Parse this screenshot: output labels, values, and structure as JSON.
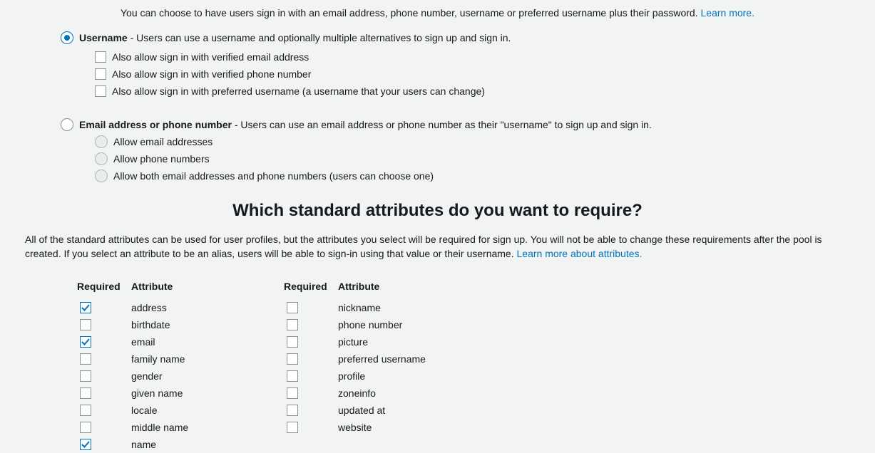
{
  "intro": {
    "text": "You can choose to have users sign in with an email address, phone number, username or preferred username plus their password. ",
    "link": "Learn more."
  },
  "signin": {
    "username": {
      "label": "Username",
      "desc": " - Users can use a username and optionally multiple alternatives to sign up and sign in.",
      "selected": true,
      "subs": [
        {
          "label": "Also allow sign in with verified email address",
          "checked": false
        },
        {
          "label": "Also allow sign in with verified phone number",
          "checked": false
        },
        {
          "label": "Also allow sign in with preferred username (a username that your users can change)",
          "checked": false
        }
      ]
    },
    "emailphone": {
      "label": "Email address or phone number",
      "desc": " - Users can use an email address or phone number as their \"username\" to sign up and sign in.",
      "selected": false,
      "subs": [
        {
          "label": "Allow email addresses"
        },
        {
          "label": "Allow phone numbers"
        },
        {
          "label": "Allow both email addresses and phone numbers (users can choose one)"
        }
      ]
    }
  },
  "attributes": {
    "title": "Which standard attributes do you want to require?",
    "para": "All of the standard attributes can be used for user profiles, but the attributes you select will be required for sign up. You will not be able to change these requirements after the pool is created. If you select an attribute to be an alias, users will be able to sign-in using that value or their username. ",
    "link": "Learn more about attributes.",
    "hdr_required": "Required",
    "hdr_attribute": "Attribute",
    "col1": [
      {
        "name": "address",
        "checked": true
      },
      {
        "name": "birthdate",
        "checked": false
      },
      {
        "name": "email",
        "checked": true
      },
      {
        "name": "family name",
        "checked": false
      },
      {
        "name": "gender",
        "checked": false
      },
      {
        "name": "given name",
        "checked": false
      },
      {
        "name": "locale",
        "checked": false
      },
      {
        "name": "middle name",
        "checked": false
      },
      {
        "name": "name",
        "checked": true
      }
    ],
    "col2": [
      {
        "name": "nickname",
        "checked": false
      },
      {
        "name": "phone number",
        "checked": false
      },
      {
        "name": "picture",
        "checked": false
      },
      {
        "name": "preferred username",
        "checked": false
      },
      {
        "name": "profile",
        "checked": false
      },
      {
        "name": "zoneinfo",
        "checked": false
      },
      {
        "name": "updated at",
        "checked": false
      },
      {
        "name": "website",
        "checked": false
      }
    ]
  }
}
